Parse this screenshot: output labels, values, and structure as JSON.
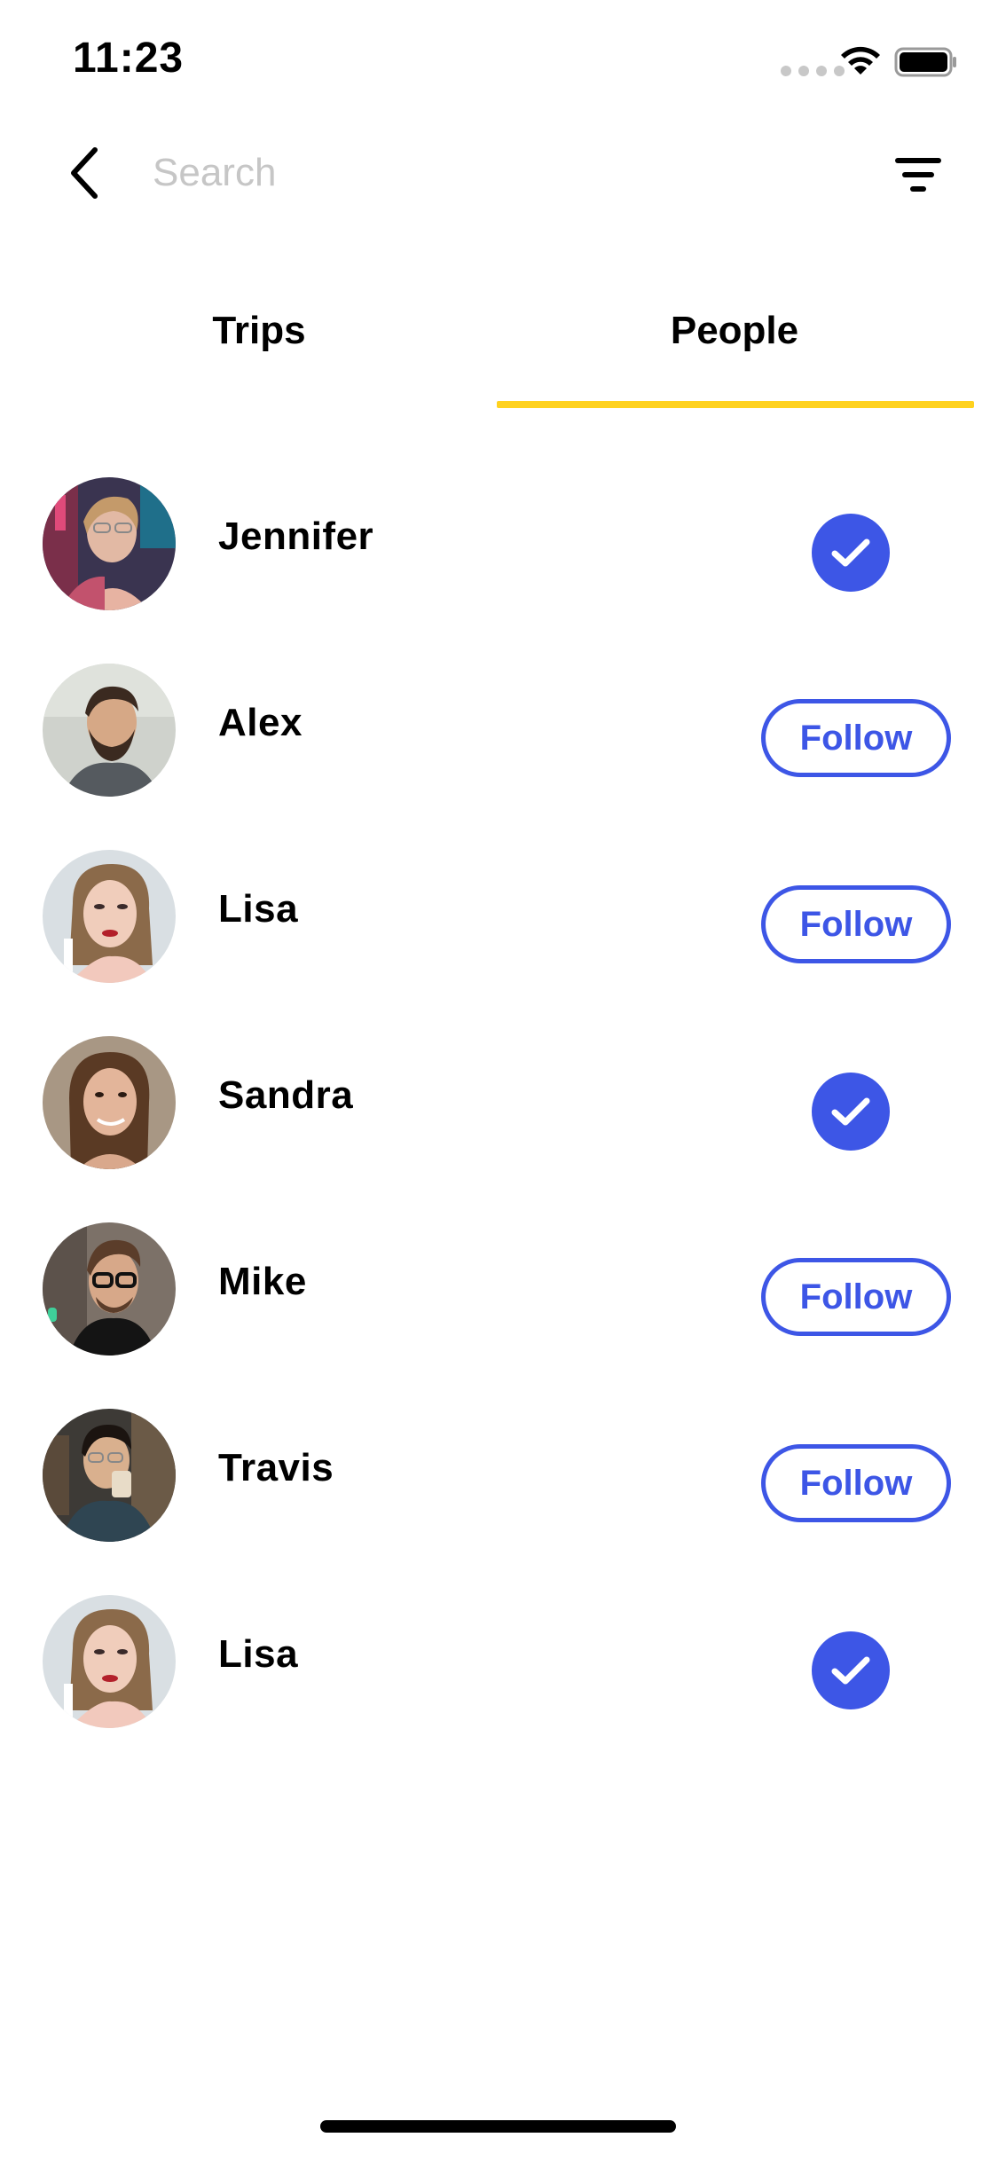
{
  "status_bar": {
    "time": "11:23"
  },
  "search": {
    "placeholder": "Search",
    "value": ""
  },
  "tabs": [
    {
      "label": "Trips",
      "active": false
    },
    {
      "label": "People",
      "active": true
    }
  ],
  "people": [
    {
      "name": "Jennifer",
      "followed": true
    },
    {
      "name": "Alex",
      "followed": false
    },
    {
      "name": "Lisa",
      "followed": false
    },
    {
      "name": "Sandra",
      "followed": true
    },
    {
      "name": "Mike",
      "followed": false
    },
    {
      "name": "Travis",
      "followed": false
    },
    {
      "name": "Lisa",
      "followed": true
    }
  ],
  "follow_label": "Follow",
  "colors": {
    "accent": "#3D56E6",
    "tab_indicator": "#FFD21F",
    "placeholder": "#C6C6C6"
  },
  "icons": {
    "back": "chevron-left-icon",
    "filter": "filter-icon",
    "followed": "check-icon"
  }
}
